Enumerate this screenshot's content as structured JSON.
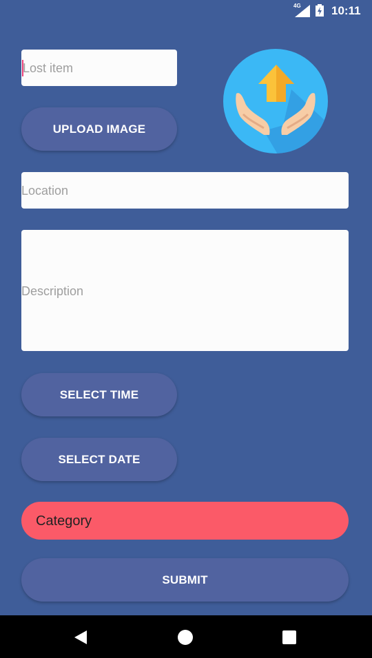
{
  "status_bar": {
    "network": "4G",
    "time": "10:11",
    "icons": [
      "signal-icon",
      "battery-charging-icon"
    ]
  },
  "form": {
    "lost_item_placeholder": "Lost item",
    "location_placeholder": "Location",
    "description_placeholder": "Description",
    "upload_button": "UPLOAD IMAGE",
    "select_time_button": "SELECT TIME",
    "select_date_button": "SELECT DATE",
    "category_label": "Category",
    "submit_button": "SUBMIT"
  },
  "logo": {
    "icon": "hands-house-icon"
  },
  "nav_bar": {
    "icons": [
      "back-icon",
      "home-icon",
      "recents-icon"
    ]
  },
  "colors": {
    "background": "#3f5d99",
    "button": "#5163a0",
    "category": "#fb5a68",
    "cursor": "#e8407a"
  }
}
